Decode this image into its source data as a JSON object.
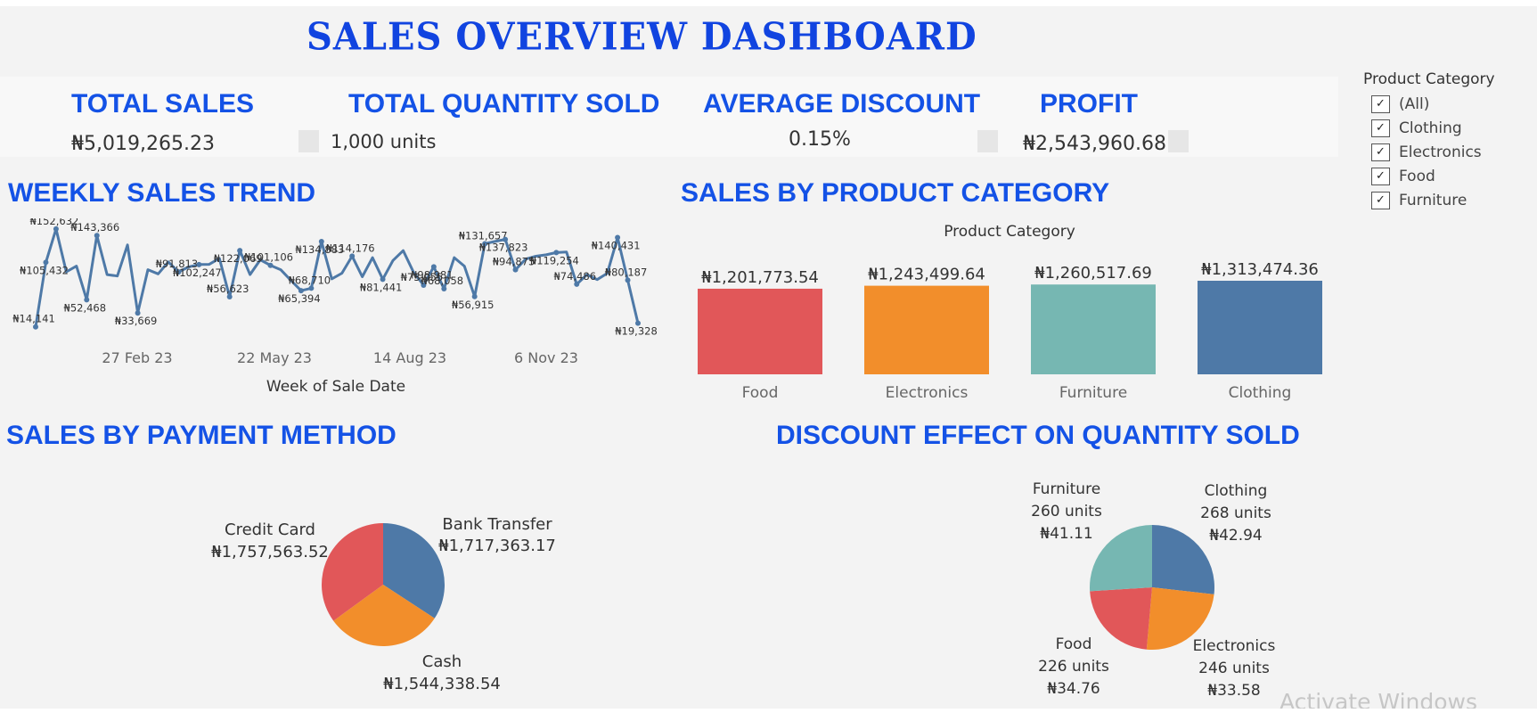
{
  "title": "SALES OVERVIEW DASHBOARD",
  "kpis": {
    "total_sales": {
      "label": "TOTAL SALES",
      "value": "₦5,019,265.23"
    },
    "total_quantity": {
      "label": "TOTAL QUANTITY SOLD",
      "value": "1,000 units"
    },
    "average_discount": {
      "label": "AVERAGE DISCOUNT",
      "value": "0.15%"
    },
    "profit": {
      "label": "PROFIT",
      "value": "₦2,543,960.68"
    }
  },
  "filter": {
    "title": "Product Category",
    "items": [
      {
        "label": "(All)",
        "checked": true
      },
      {
        "label": "Clothing",
        "checked": true
      },
      {
        "label": "Electronics",
        "checked": true
      },
      {
        "label": "Food",
        "checked": true
      },
      {
        "label": "Furniture",
        "checked": true
      }
    ]
  },
  "sections": {
    "weekly": "WEEKLY SALES TREND",
    "category": "SALES BY PRODUCT CATEGORY",
    "payment": "SALES BY PAYMENT METHOD",
    "discount": "DISCOUNT EFFECT ON QUANTITY SOLD"
  },
  "watermark": "Activate Windows",
  "colors": {
    "heading": "#1452e6",
    "title": "#1144e0",
    "line": "#4e79a7",
    "red": "#e15759",
    "orange": "#f28e2b",
    "teal": "#76b7b2",
    "blue": "#4e79a7"
  },
  "chart_data": [
    {
      "type": "line",
      "xlabel": "Week of Sale Date",
      "ylabel": "",
      "x_ticks": [
        "27 Feb 23",
        "22 May 23",
        "14 Aug 23",
        "6 Nov 23"
      ],
      "series": [
        {
          "values": [
            14141,
            105432,
            152632,
            92000,
            100000,
            52468,
            143366,
            88000,
            86000,
            130000,
            33669,
            95000,
            89000,
            106000,
            91813,
            99000,
            102247,
            102500,
            111000,
            56623,
            122069,
            88000,
            109000,
            101106,
            95000,
            80000,
            65394,
            68710,
            134883,
            82000,
            90000,
            114176,
            85000,
            112000,
            81441,
            108000,
            122000,
            92000,
            73055,
            98981,
            68058,
            112000,
            100000,
            56915,
            131657,
            135000,
            137823,
            94875,
            110000,
            114000,
            116000,
            119254,
            120000,
            74486,
            88000,
            81000,
            90000,
            140431,
            80187,
            19328
          ]
        }
      ],
      "labeled_points": [
        {
          "label": "₦14,141",
          "value": 14141
        },
        {
          "label": "₦105,432",
          "value": 105432
        },
        {
          "label": "₦152,632",
          "value": 152632
        },
        {
          "label": "₦52,468",
          "value": 52468
        },
        {
          "label": "₦143,366",
          "value": 143366
        },
        {
          "label": "₦33,669",
          "value": 33669
        },
        {
          "label": "₦91,813",
          "value": 91813
        },
        {
          "label": "₦102,247",
          "value": 102247
        },
        {
          "label": "₦56,623",
          "value": 56623
        },
        {
          "label": "₦122,069",
          "value": 122069
        },
        {
          "label": "₦101,106",
          "value": 101106
        },
        {
          "label": "₦65,394",
          "value": 65394
        },
        {
          "label": "₦68,710",
          "value": 68710
        },
        {
          "label": "₦134,883",
          "value": 134883
        },
        {
          "label": "₦114,176",
          "value": 114176
        },
        {
          "label": "₦81,441",
          "value": 81441
        },
        {
          "label": "₦73,055",
          "value": 73055
        },
        {
          "label": "₦98,981",
          "value": 98981
        },
        {
          "label": "₦68,058",
          "value": 68058
        },
        {
          "label": "₦56,915",
          "value": 56915
        },
        {
          "label": "₦131,657",
          "value": 131657
        },
        {
          "label": "₦137,823",
          "value": 137823
        },
        {
          "label": "₦94,875",
          "value": 94875
        },
        {
          "label": "₦119,254",
          "value": 119254
        },
        {
          "label": "₦74,486",
          "value": 74486
        },
        {
          "label": "₦140,431",
          "value": 140431
        },
        {
          "label": "₦80,187",
          "value": 80187
        },
        {
          "label": "₦19,328",
          "value": 19328
        }
      ]
    },
    {
      "type": "bar",
      "title": "Product Category",
      "categories": [
        "Food",
        "Electronics",
        "Furniture",
        "Clothing"
      ],
      "values": [
        1201773.54,
        1243499.64,
        1260517.69,
        1313474.36
      ],
      "labels": [
        "₦1,201,773.54",
        "₦1,243,499.64",
        "₦1,260,517.69",
        "₦1,313,474.36"
      ],
      "colors": [
        "#e15759",
        "#f28e2b",
        "#76b7b2",
        "#4e79a7"
      ]
    },
    {
      "type": "pie",
      "slices": [
        {
          "name": "Bank Transfer",
          "value": 1717363.17,
          "label": "₦1,717,363.17",
          "color": "#4e79a7"
        },
        {
          "name": "Cash",
          "value": 1544338.54,
          "label": "₦1,544,338.54",
          "color": "#f28e2b"
        },
        {
          "name": "Credit Card",
          "value": 1757563.52,
          "label": "₦1,757,563.52",
          "color": "#e15759"
        }
      ]
    },
    {
      "type": "pie",
      "slices": [
        {
          "name": "Clothing",
          "value": 268,
          "units": "268 units",
          "discount": "₦42.94",
          "color": "#4e79a7"
        },
        {
          "name": "Electronics",
          "value": 246,
          "units": "246 units",
          "discount": "₦33.58",
          "color": "#f28e2b"
        },
        {
          "name": "Food",
          "value": 226,
          "units": "226 units",
          "discount": "₦34.76",
          "color": "#e15759"
        },
        {
          "name": "Furniture",
          "value": 260,
          "units": "260 units",
          "discount": "₦41.11",
          "color": "#76b7b2"
        }
      ]
    }
  ]
}
